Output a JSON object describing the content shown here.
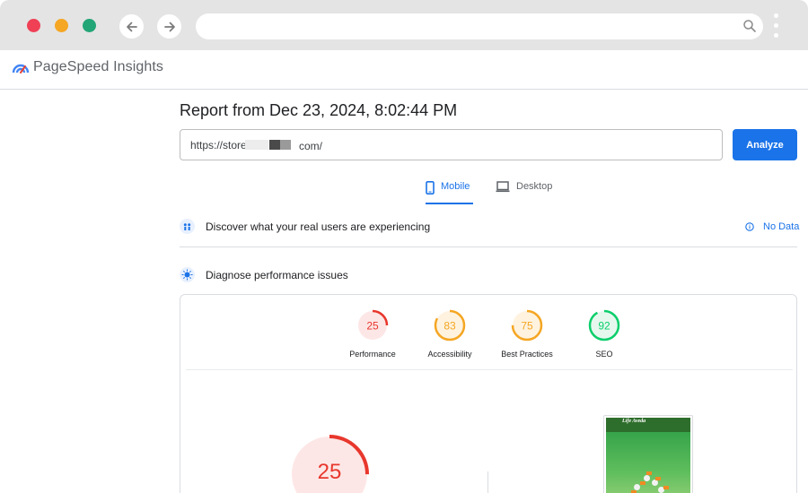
{
  "app": {
    "name": "PageSpeed Insights"
  },
  "report": {
    "title": "Report from Dec 23, 2024, 8:02:44 PM",
    "url_value": "https://store.",
    "url_suffix": "com/",
    "analyze_label": "Analyze"
  },
  "tabs": [
    {
      "label": "Mobile",
      "icon": "smartphone-icon",
      "selected": true
    },
    {
      "label": "Desktop",
      "icon": "laptop-icon",
      "selected": false
    }
  ],
  "sections": {
    "discover": {
      "label": "Discover what your real users are experiencing",
      "status": "No Data",
      "icon": "users-icon"
    },
    "diagnose": {
      "label": "Diagnose performance issues",
      "icon": "lighthouse-icon"
    }
  },
  "scores": [
    {
      "label": "Performance",
      "value": 25,
      "color": "#e8372d",
      "bg": "#fde7e6"
    },
    {
      "label": "Accessibility",
      "value": 83,
      "color": "#f5a623",
      "bg": "#fff3e0"
    },
    {
      "label": "Best Practices",
      "value": 75,
      "color": "#f5a623",
      "bg": "#fff3e0"
    },
    {
      "label": "SEO",
      "value": 92,
      "color": "#0cce6b",
      "bg": "#e6f8ee"
    }
  ],
  "main_score": {
    "value": "25",
    "fraction": 0.25,
    "color": "#e8372d",
    "bg": "#fde7e6"
  },
  "thumbnail": {
    "site_name": "Life Aveda"
  },
  "colors": {
    "accent": "#1a73e8",
    "fail": "#e8372d",
    "average": "#f5a623",
    "pass": "#0cce6b"
  }
}
